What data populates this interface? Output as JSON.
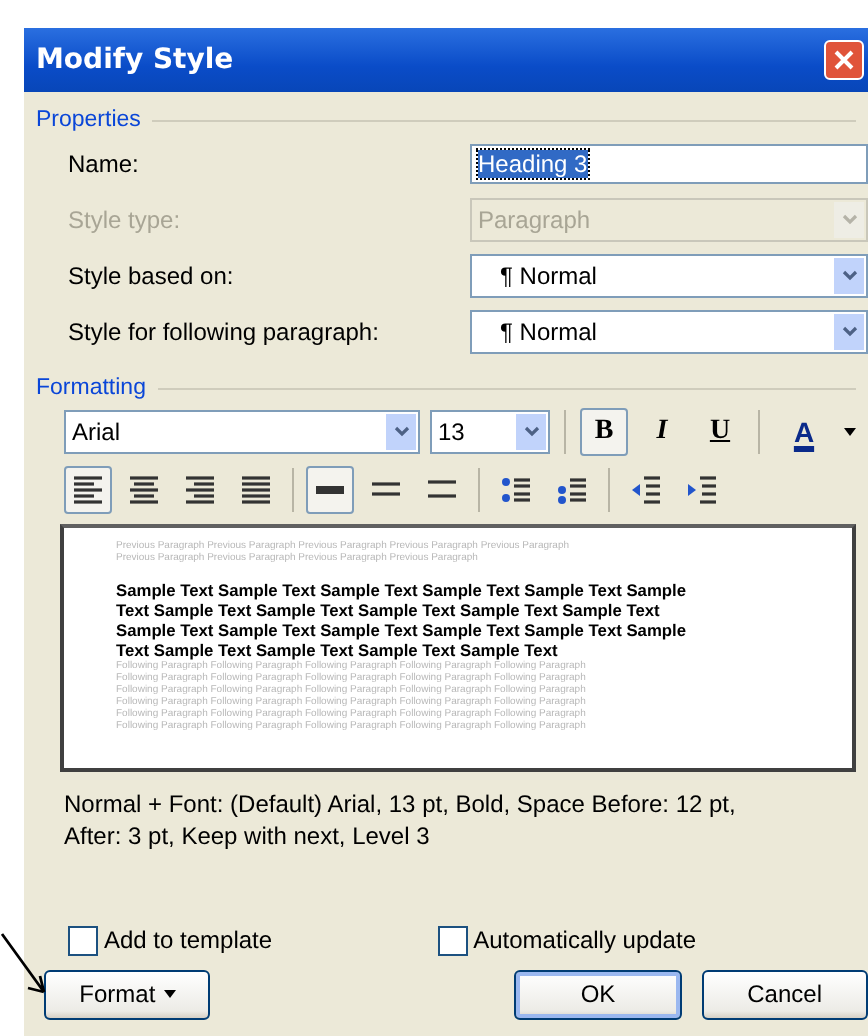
{
  "window": {
    "title": "Modify Style"
  },
  "properties": {
    "label": "Properties",
    "rows": [
      {
        "label": "Name:",
        "kind": "text",
        "value": "Heading 3",
        "highlighted": true,
        "disabled": false
      },
      {
        "label": "Style type:",
        "kind": "select",
        "value": "Paragraph",
        "disabled": true
      },
      {
        "label": "Style based on:",
        "kind": "select",
        "value": "¶ Normal",
        "disabled": false
      },
      {
        "label": "Style for following paragraph:",
        "kind": "select",
        "value": "¶ Normal",
        "disabled": false
      }
    ]
  },
  "formatting": {
    "label": "Formatting",
    "font": "Arial",
    "size": "13",
    "text_buttons": [
      {
        "label": "B",
        "kind": "bold",
        "selected": true
      },
      {
        "label": "I",
        "kind": "italic",
        "selected": false
      },
      {
        "label": "U",
        "kind": "underline",
        "selected": false
      },
      {
        "label": "A",
        "kind": "font-color",
        "selected": false
      }
    ],
    "paragraph_buttons": [
      {
        "kind": "align-left",
        "selected": true
      },
      {
        "kind": "align-center",
        "selected": false
      },
      {
        "kind": "align-right",
        "selected": false
      },
      {
        "kind": "justify",
        "selected": false
      },
      {
        "kind": "single-spacing",
        "selected": true
      },
      {
        "kind": "one-half-spacing",
        "selected": false
      },
      {
        "kind": "double-spacing",
        "selected": false
      },
      {
        "kind": "space-before-up",
        "selected": false
      },
      {
        "kind": "space-before-down",
        "selected": false
      },
      {
        "kind": "indent-decrease",
        "selected": false
      },
      {
        "kind": "indent-increase",
        "selected": false
      }
    ]
  },
  "preview": {
    "previous": [
      "Previous Paragraph Previous Paragraph Previous Paragraph Previous Paragraph Previous Paragraph",
      "Previous Paragraph Previous Paragraph Previous Paragraph Previous Paragraph"
    ],
    "sample": [
      "Sample Text Sample Text Sample Text Sample Text Sample Text Sample",
      "Text Sample Text Sample Text Sample Text Sample Text Sample Text",
      "Sample Text Sample Text Sample Text Sample Text Sample Text Sample",
      "Text Sample Text Sample Text Sample Text Sample Text"
    ],
    "following": [
      "Following Paragraph Following Paragraph Following Paragraph Following Paragraph Following Paragraph",
      "Following Paragraph Following Paragraph Following Paragraph Following Paragraph Following Paragraph",
      "Following Paragraph Following Paragraph Following Paragraph Following Paragraph Following Paragraph",
      "Following Paragraph Following Paragraph Following Paragraph Following Paragraph Following Paragraph",
      "Following Paragraph Following Paragraph Following Paragraph Following Paragraph Following Paragraph",
      "Following Paragraph Following Paragraph Following Paragraph Following Paragraph Following Paragraph"
    ]
  },
  "description": [
    "Normal + Font: (Default) Arial, 13 pt, Bold, Space Before:  12 pt,",
    "After:  3 pt, Keep with next, Level 3"
  ],
  "checkboxes": [
    {
      "label": "Add to template",
      "checked": false
    },
    {
      "label": "Automatically update",
      "checked": false
    }
  ],
  "buttons": [
    {
      "label": "Format",
      "kind": "menu"
    },
    {
      "label": "OK",
      "kind": "default"
    },
    {
      "label": "Cancel",
      "kind": "plain"
    }
  ]
}
